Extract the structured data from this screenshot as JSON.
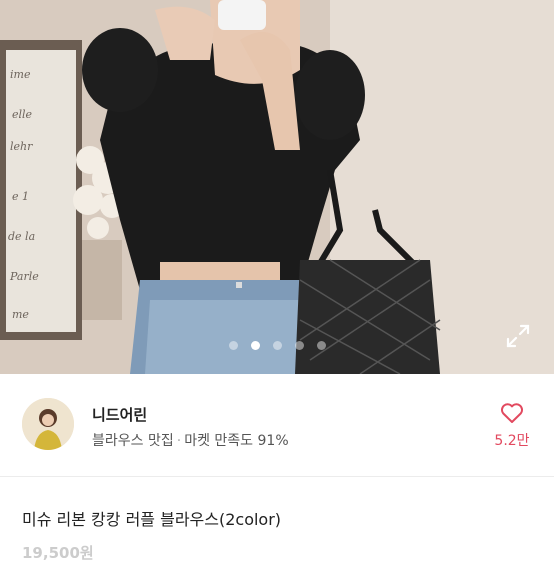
{
  "seller": {
    "name": "니드어린",
    "category": "블라우스 맛집",
    "separator": "·",
    "market_label": "마켓 만족도",
    "satisfaction": "91%"
  },
  "likes": {
    "count": "5.2만"
  },
  "product": {
    "title": "미슈 리본 캉캉 러플 블라우스(2color)",
    "price": "19,500원"
  },
  "carousel": {
    "total": 5,
    "active_index": 1
  },
  "colors": {
    "accent": "#e2495f"
  }
}
